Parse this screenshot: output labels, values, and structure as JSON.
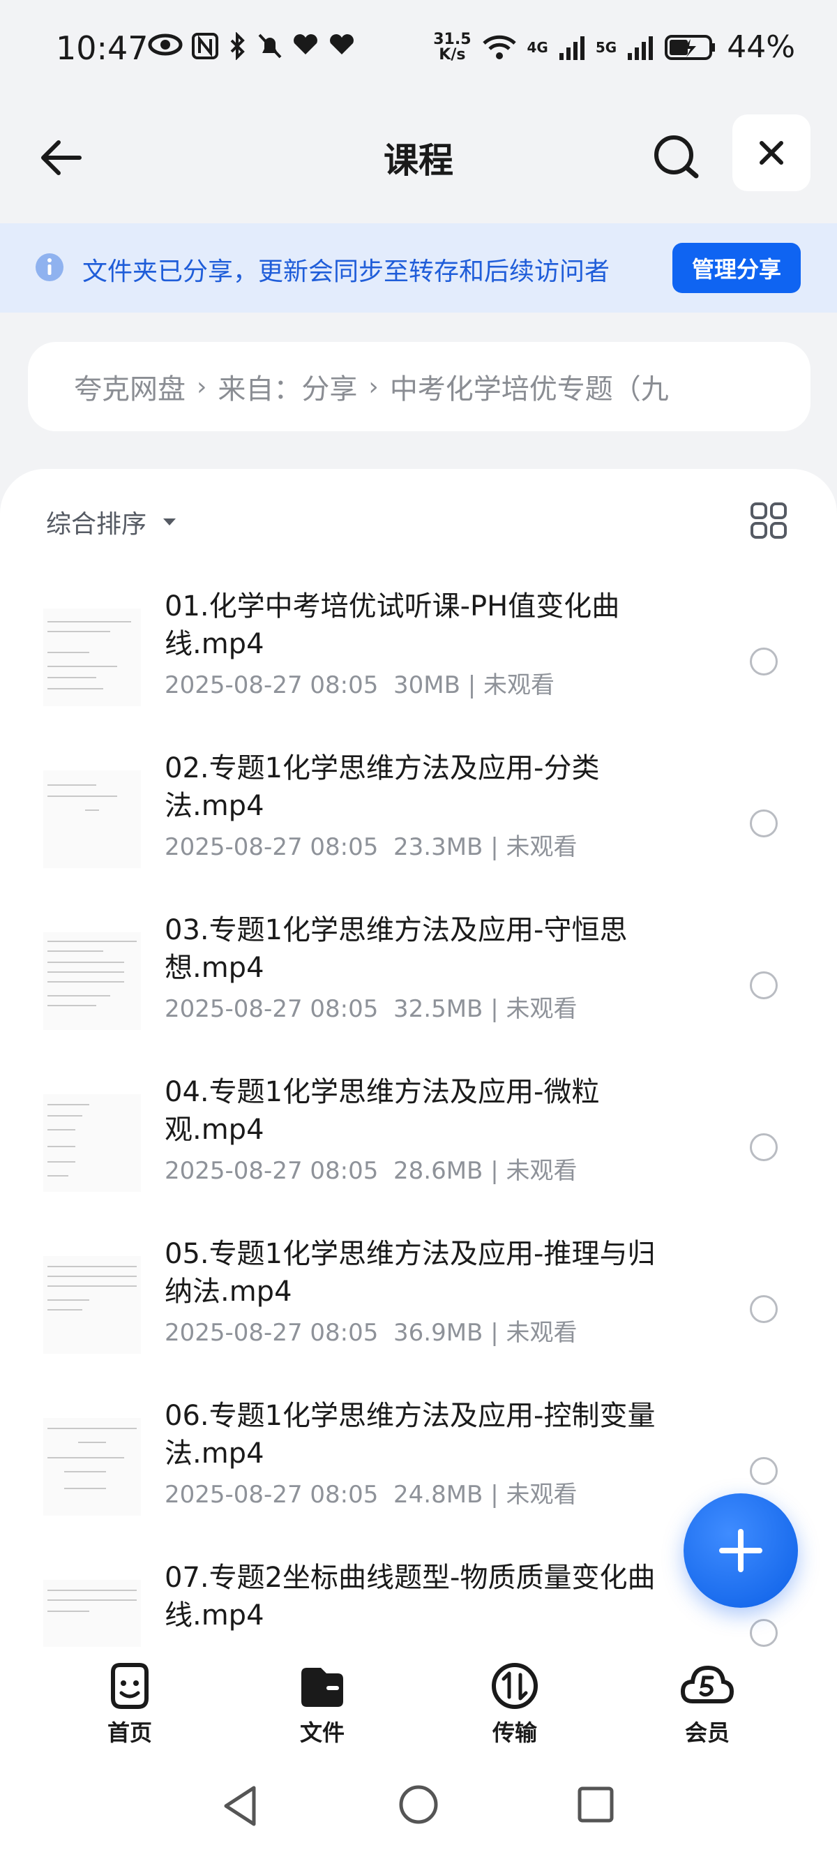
{
  "status_bar": {
    "time": "10:47",
    "net_speed_value": "31.5",
    "net_speed_unit": "K/s",
    "network_4g": "4G",
    "network_5g": "5G",
    "battery": "44%"
  },
  "header": {
    "title": "课程"
  },
  "share_banner": {
    "text": "文件夹已分享，更新会同步至转存和后续访问者",
    "button_label": "管理分享"
  },
  "breadcrumb": {
    "items": [
      "夸克网盘",
      "来自：分享",
      "中考化学培优专题（九"
    ]
  },
  "sort": {
    "label": "综合排序"
  },
  "files": [
    {
      "name": "01.化学中考培优试听课-PH值变化曲线.mp4",
      "date": "2025-08-27 08:05",
      "size": "30MB",
      "status": "未观看"
    },
    {
      "name": "02.专题1化学思维方法及应用-分类法.mp4",
      "date": "2025-08-27 08:05",
      "size": "23.3MB",
      "status": "未观看"
    },
    {
      "name": "03.专题1化学思维方法及应用-守恒思想.mp4",
      "date": "2025-08-27 08:05",
      "size": "32.5MB",
      "status": "未观看"
    },
    {
      "name": "04.专题1化学思维方法及应用-微粒观.mp4",
      "date": "2025-08-27 08:05",
      "size": "28.6MB",
      "status": "未观看"
    },
    {
      "name": "05.专题1化学思维方法及应用-推理与归纳法.mp4",
      "date": "2025-08-27 08:05",
      "size": "36.9MB",
      "status": "未观看"
    },
    {
      "name": "06.专题1化学思维方法及应用-控制变量法.mp4",
      "date": "2025-08-27 08:05",
      "size": "24.8MB",
      "status": "未观看"
    },
    {
      "name": "07.专题2坐标曲线题型-物质质量变化曲线.mp4",
      "date": "",
      "size": "",
      "status": ""
    }
  ],
  "bottom_nav": {
    "items": [
      {
        "label": "首页",
        "icon": "home-face-icon"
      },
      {
        "label": "文件",
        "icon": "folder-icon"
      },
      {
        "label": "传输",
        "icon": "transfer-icon"
      },
      {
        "label": "会员",
        "icon": "vip-cloud-icon"
      }
    ]
  },
  "colors": {
    "accent": "#0f64f2",
    "banner_bg": "#e3ecfc",
    "banner_text": "#1f5dd9",
    "page_bg": "#f2f3f5"
  }
}
